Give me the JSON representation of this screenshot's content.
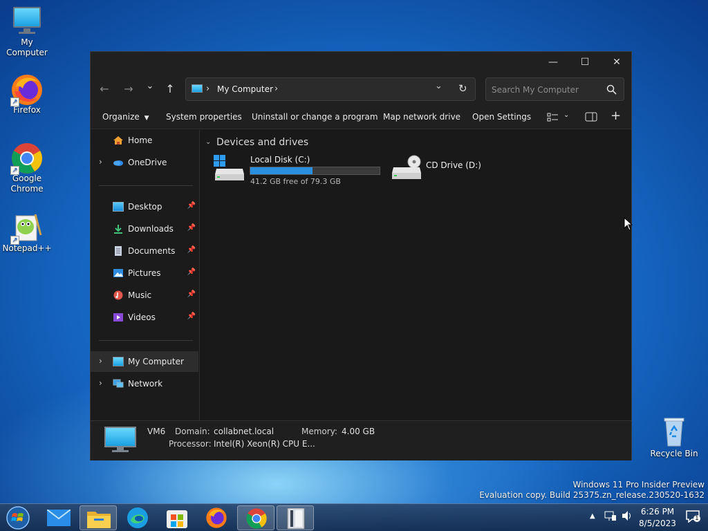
{
  "desktop": {
    "icons": [
      {
        "label": "My Computer"
      },
      {
        "label": "Firefox"
      },
      {
        "label": "Google Chrome"
      },
      {
        "label": "Notepad++"
      },
      {
        "label": "Recycle Bin"
      }
    ],
    "watermark_line1": "Windows 11 Pro Insider Preview",
    "watermark_line2": "Evaluation copy. Build 25375.zn_release.230520-1632"
  },
  "window": {
    "controls": {
      "minimize": "—",
      "maximize": "☐",
      "close": "✕"
    },
    "nav": {
      "back": "←",
      "forward": "→",
      "recent": "⌄",
      "up": "↑"
    },
    "address": {
      "sep1": "›",
      "location": "My Computer",
      "sep2": "›",
      "dropdown": "⌄",
      "refresh": "↻"
    },
    "search": {
      "placeholder": "Search My Computer"
    },
    "commands": {
      "organize": "Organize",
      "system_properties": "System properties",
      "uninstall": "Uninstall or change a program",
      "map_drive": "Map network drive",
      "open_settings": "Open Settings"
    },
    "sidebar": {
      "home": "Home",
      "onedrive": "OneDrive",
      "quick": [
        {
          "label": "Desktop"
        },
        {
          "label": "Downloads"
        },
        {
          "label": "Documents"
        },
        {
          "label": "Pictures"
        },
        {
          "label": "Music"
        },
        {
          "label": "Videos"
        }
      ],
      "my_computer": "My Computer",
      "network": "Network"
    },
    "content": {
      "group_title": "Devices and drives",
      "drives": [
        {
          "name": "Local Disk (C:)",
          "free_text": "41.2 GB free of 79.3 GB",
          "used_fraction": 0.48
        },
        {
          "name": "CD Drive (D:)"
        }
      ]
    },
    "details": {
      "computer_name": "VM6",
      "domain_label": "Domain:",
      "domain_value": "collabnet.local",
      "memory_label": "Memory:",
      "memory_value": "4.00 GB",
      "processor_label": "Processor:",
      "processor_value": "Intel(R) Xeon(R) CPU E..."
    }
  },
  "taskbar": {
    "clock_time": "6:26 PM",
    "clock_date": "8/5/2023",
    "notification_count": "1"
  }
}
